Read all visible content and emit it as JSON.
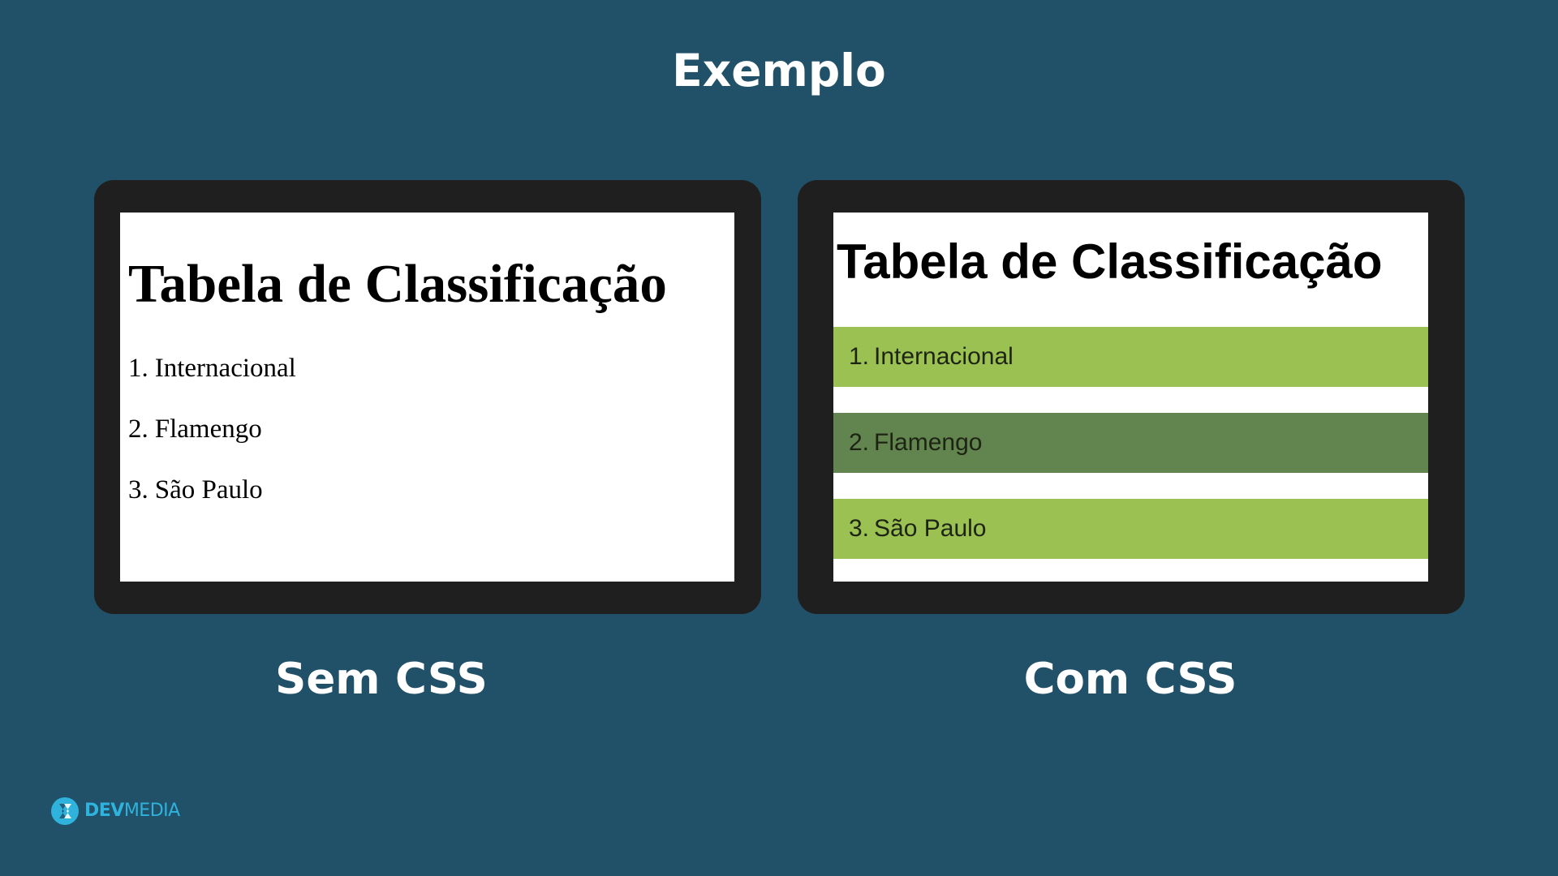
{
  "slide": {
    "title": "Exemplo"
  },
  "panels": [
    {
      "caption": "Sem CSS",
      "heading": "Tabela de Classificação",
      "items": [
        {
          "number": "1.",
          "team": "Internacional"
        },
        {
          "number": "2.",
          "team": "Flamengo"
        },
        {
          "number": "3.",
          "team": "São Paulo"
        }
      ]
    },
    {
      "caption": "Com CSS",
      "heading": "Tabela de Classificação",
      "items": [
        {
          "number": "1.",
          "team": "Internacional",
          "color": "#9bc153"
        },
        {
          "number": "2.",
          "team": "Flamengo",
          "color": "#62844f"
        },
        {
          "number": "3.",
          "team": "São Paulo",
          "color": "#9bc153"
        }
      ]
    }
  ],
  "logo": {
    "part1": "DEV",
    "part2": "MEDIA",
    "icon": "devmedia-logo-icon"
  },
  "colors": {
    "background": "#215069",
    "frame": "#1f1f1f",
    "accent": "#2fb3dc"
  }
}
